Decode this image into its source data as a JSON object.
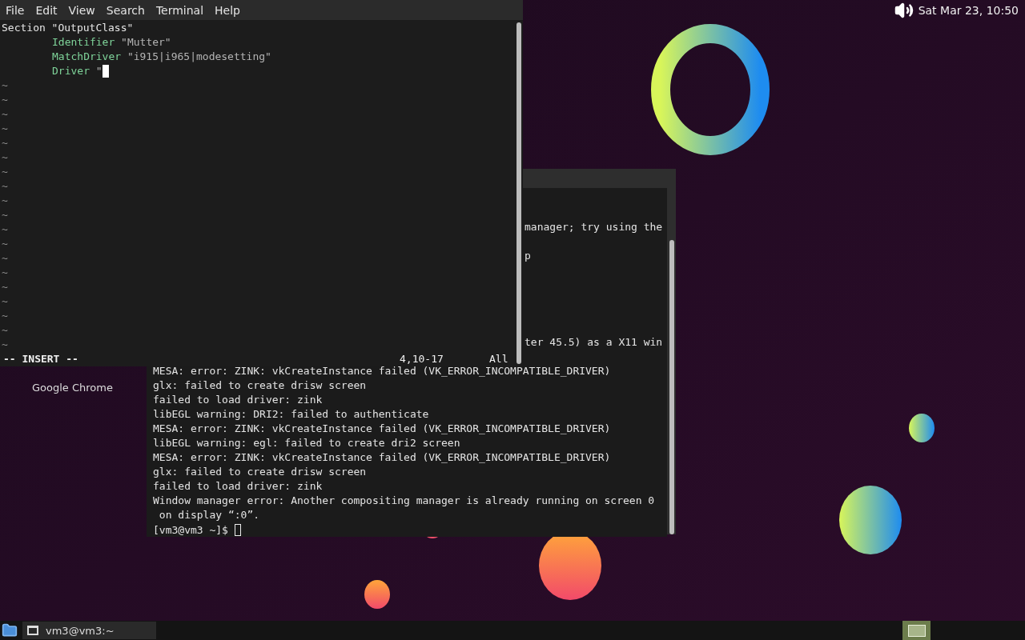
{
  "top_panel": {
    "clock": "Sat Mar 23, 10:50"
  },
  "desktop_icons": [
    {
      "label": "Google Chrome"
    }
  ],
  "vim_window": {
    "menu": [
      "File",
      "Edit",
      "View",
      "Search",
      "Terminal",
      "Help"
    ],
    "lines": [
      {
        "indented": false,
        "parts": [
          {
            "kind": "plain",
            "text": "Section"
          },
          {
            "kind": "plain",
            "text": "\"OutputClass\""
          }
        ]
      },
      {
        "indented": true,
        "parts": [
          {
            "kind": "keyword",
            "text": "Identifier"
          },
          {
            "kind": "string",
            "text": "\"Mutter\""
          }
        ]
      },
      {
        "indented": true,
        "parts": [
          {
            "kind": "keyword",
            "text": "MatchDriver"
          },
          {
            "kind": "string",
            "text": "\"i915|i965|modesetting\""
          }
        ]
      },
      {
        "indented": true,
        "cursor": true,
        "parts": [
          {
            "kind": "keyword",
            "text": "Driver"
          },
          {
            "kind": "string",
            "text": "\""
          }
        ]
      }
    ],
    "filler_lines": [
      "~",
      "~",
      "~",
      "~",
      "~",
      "~",
      "~",
      "~",
      "~",
      "~",
      "~",
      "~",
      "~",
      "~",
      "~",
      "~",
      "~",
      "~",
      "~"
    ],
    "status": {
      "mode": "-- INSERT --",
      "position": "4,10-17",
      "scroll": "All"
    }
  },
  "terminal_window": {
    "lines": [
      {
        "kind": "blank"
      },
      {
        "kind": "blank"
      },
      {
        "kind": "clipped",
        "text": "manager; try using the"
      },
      {
        "kind": "blank"
      },
      {
        "kind": "clipped",
        "text": "p"
      },
      {
        "kind": "blank"
      },
      {
        "kind": "blank"
      },
      {
        "kind": "blank"
      },
      {
        "kind": "blank"
      },
      {
        "kind": "blank"
      },
      {
        "kind": "clipped",
        "text": "ter 45.5) as a X11 win"
      },
      {
        "kind": "blank"
      },
      {
        "kind": "full",
        "text": "MESA: error: ZINK: vkCreateInstance failed (VK_ERROR_INCOMPATIBLE_DRIVER)"
      },
      {
        "kind": "full",
        "text": "glx: failed to create drisw screen"
      },
      {
        "kind": "full",
        "text": "failed to load driver: zink"
      },
      {
        "kind": "full",
        "text": "libEGL warning: DRI2: failed to authenticate"
      },
      {
        "kind": "full",
        "text": "MESA: error: ZINK: vkCreateInstance failed (VK_ERROR_INCOMPATIBLE_DRIVER)"
      },
      {
        "kind": "full",
        "text": "libEGL warning: egl: failed to create dri2 screen"
      },
      {
        "kind": "full",
        "text": "MESA: error: ZINK: vkCreateInstance failed (VK_ERROR_INCOMPATIBLE_DRIVER)"
      },
      {
        "kind": "full",
        "text": "glx: failed to create drisw screen"
      },
      {
        "kind": "full",
        "text": "failed to load driver: zink"
      },
      {
        "kind": "full",
        "text": "Window manager error: Another compositing manager is already running on screen 0"
      },
      {
        "kind": "full",
        "text": " on display “:0”."
      }
    ],
    "prompt": "[vm3@vm3 ~]$"
  },
  "taskbar": {
    "tasks": [
      {
        "label": "vm3@vm3:~"
      }
    ]
  }
}
